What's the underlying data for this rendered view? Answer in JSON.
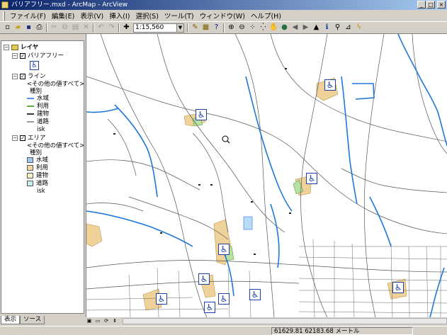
{
  "window": {
    "title": "バリアフリー.mxd - ArcMap - ArcView"
  },
  "window_buttons": {
    "minimize": "_",
    "maximize": "□",
    "close": "×"
  },
  "menu": [
    "ファイル(F)",
    "編集(E)",
    "表示(V)",
    "挿入(I)",
    "選択(S)",
    "ツール(T)",
    "ウィンドウ(W)",
    "ヘルプ(H)"
  ],
  "toolbar": {
    "scale": "1:15,560",
    "icons": [
      "new-icon",
      "open-icon",
      "save-icon",
      "print-icon",
      "cut-icon",
      "copy-icon",
      "paste-icon",
      "delete-icon",
      "undo-icon",
      "redo-icon",
      "add-data-icon",
      "editor-icon",
      "arccatalog-icon",
      "whats-this-icon",
      "zoom-in-icon",
      "zoom-out-icon",
      "fixed-zoom-in-icon",
      "fixed-zoom-out-icon",
      "pan-icon",
      "full-extent-icon",
      "back-icon",
      "forward-icon",
      "select-icon",
      "identify-icon",
      "find-icon",
      "measure-icon",
      "hyperlink-icon"
    ]
  },
  "toc": {
    "root": "レイヤ",
    "layers": [
      {
        "name": "バリアフリー"
      },
      {
        "name": "ライン",
        "default": "<その他の値すべて>",
        "field": "種別",
        "items": [
          {
            "label": "水域",
            "color": "#5b8ee6"
          },
          {
            "label": "利用",
            "color": "#5fb040"
          },
          {
            "label": "建物",
            "color": "#333333"
          },
          {
            "label": "道路",
            "color": "#9a9a9a"
          },
          {
            "label": "isk",
            "color": ""
          }
        ]
      },
      {
        "name": "エリア",
        "default": "<その他の値すべて>",
        "field": "種別",
        "items": [
          {
            "label": "水域",
            "color": "#a4c8f0"
          },
          {
            "label": "利用",
            "color": "#f2d8a6"
          },
          {
            "label": "建物",
            "color": "#f5f0c8"
          },
          {
            "label": "道路",
            "color": "#c8eef0"
          },
          {
            "label": "isk",
            "color": ""
          }
        ]
      }
    ],
    "tabs": [
      "表示",
      "ソース"
    ]
  },
  "status": {
    "coords": "61629.81  62183.68 メートル"
  },
  "map": {
    "water_color": "#1e78d8",
    "road_color": "#555555",
    "area_color": "#efd29a",
    "symbol_glyph": "♿"
  }
}
